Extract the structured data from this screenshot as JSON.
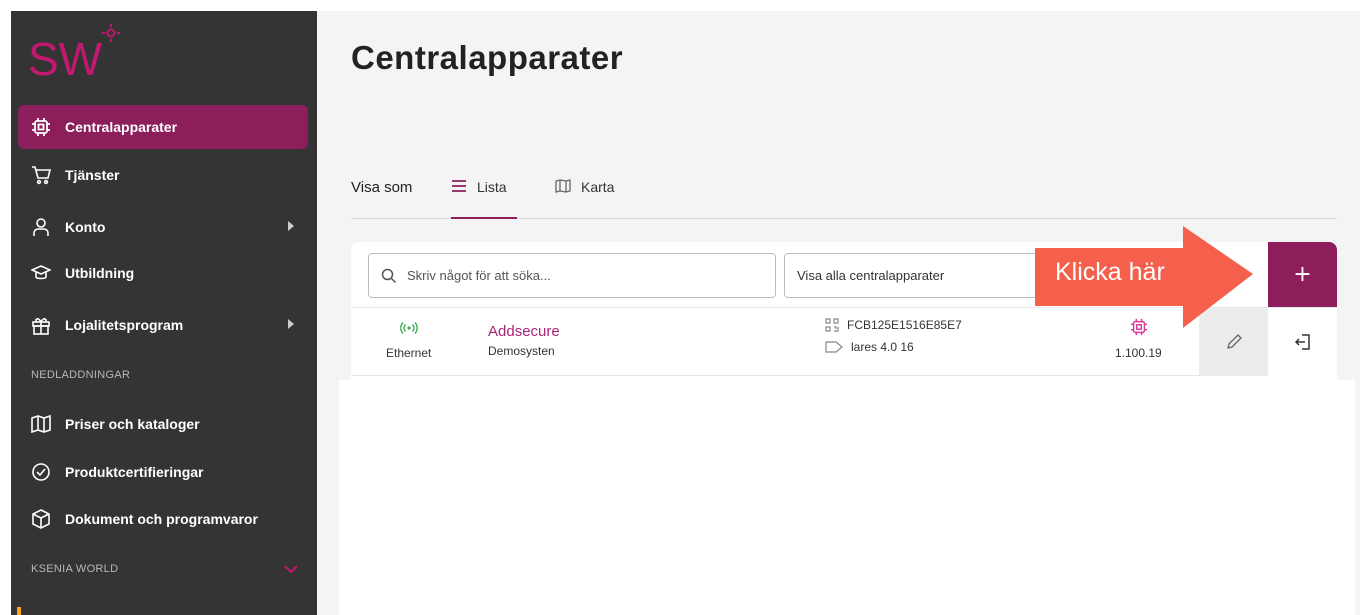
{
  "sidebar": {
    "logo_text": "SW",
    "items": [
      {
        "label": "Centralapparater",
        "icon": "chip-icon",
        "active": true
      },
      {
        "label": "Tjänster",
        "icon": "cart-icon"
      },
      {
        "label": "Konto",
        "icon": "user-icon",
        "expandable": true
      },
      {
        "label": "Utbildning",
        "icon": "graduation-icon"
      },
      {
        "label": "Lojalitetsprogram",
        "icon": "gift-icon",
        "expandable": true
      }
    ],
    "downloads_label": "NEDLADDNINGAR",
    "downloads": [
      {
        "label": "Priser och kataloger",
        "icon": "book-icon"
      },
      {
        "label": "Produktcertifieringar",
        "icon": "check-circle-icon"
      },
      {
        "label": "Dokument och programvaror",
        "icon": "box-icon"
      }
    ],
    "world_label": "KSENIA WORLD"
  },
  "main": {
    "title": "Centralapparater",
    "view_label": "Visa som",
    "tabs": [
      {
        "label": "Lista",
        "icon": "list-icon",
        "active": true
      },
      {
        "label": "Karta",
        "icon": "map-icon"
      }
    ],
    "search_placeholder": "Skriv något för att söka...",
    "filter_value": "Visa alla centralapparater",
    "add_label": "+",
    "rows": [
      {
        "connection": "Ethernet",
        "name": "Addsecure",
        "subtitle": "Demosysten",
        "serial": "FCB125E1516E85E7",
        "model": "lares 4.0 16",
        "firmware": "1.100.19"
      }
    ]
  },
  "callout": {
    "text": "Klicka här"
  },
  "colors": {
    "accent": "#8c1e5c",
    "sidebar_bg": "#343434",
    "callout": "#f4604b",
    "connection_ok": "#2fae4a"
  }
}
